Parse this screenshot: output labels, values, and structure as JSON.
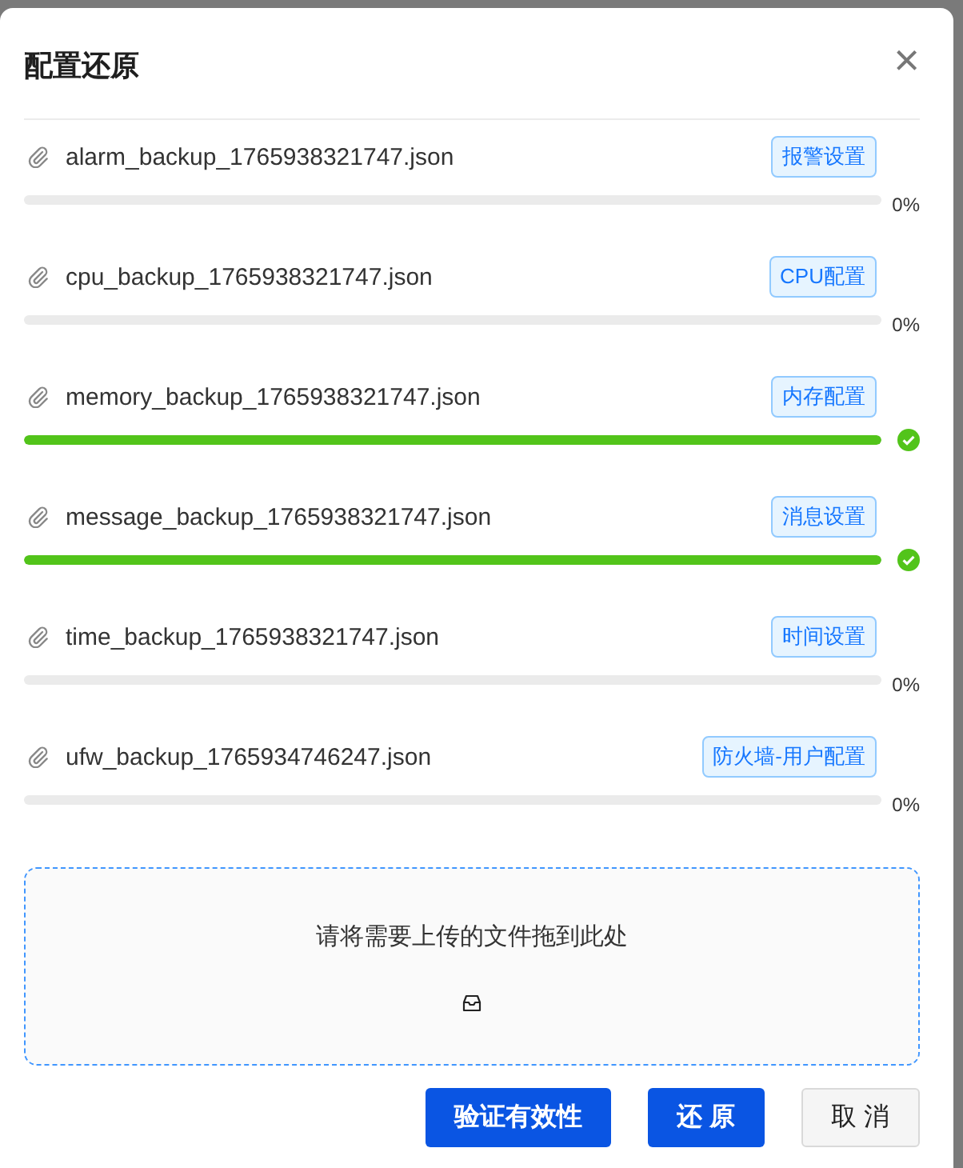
{
  "dialog": {
    "title": "配置还原",
    "close": "×"
  },
  "files": [
    {
      "name": "alarm_backup_1765938321747.json",
      "tag": "报警设置",
      "level": 0,
      "done": false,
      "percent": "0%"
    },
    {
      "name": "cpu_backup_1765938321747.json",
      "tag": "CPU配置",
      "level": 0,
      "done": false,
      "percent": "0%"
    },
    {
      "name": "memory_backup_1765938321747.json",
      "tag": "内存配置",
      "level": 1,
      "done": true
    },
    {
      "name": "message_backup_1765938321747.json",
      "tag": "消息设置",
      "level": 1,
      "done": true
    },
    {
      "name": "time_backup_1765938321747.json",
      "tag": "时间设置",
      "level": 0,
      "done": false,
      "percent": "0%"
    },
    {
      "name": "ufw_backup_1765934746247.json",
      "tag": "防火墙-用户配置",
      "level": 0,
      "done": false,
      "percent": "0%"
    }
  ],
  "dropzone": {
    "hint": "请将需要上传的文件拖到此处"
  },
  "buttons": [
    {
      "label": "验证有效性",
      "kind": "primary"
    },
    {
      "label": "还 原",
      "kind": "primary"
    },
    {
      "label": "取 消",
      "kind": "default"
    }
  ]
}
